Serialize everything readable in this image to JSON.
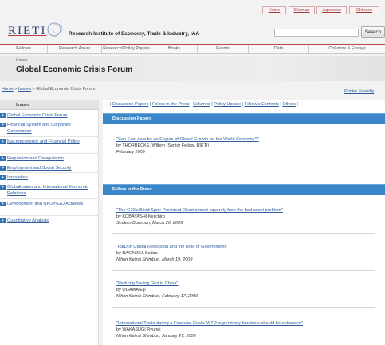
{
  "top_links": [
    "Home",
    "Sitemap",
    "Japanese",
    "Chinese"
  ],
  "logo": {
    "text": "RIETI",
    "institute": "Research Institute of Economy, Trade & Industry, IAA"
  },
  "search": {
    "button": "Search",
    "value": ""
  },
  "nav": [
    "Fellows",
    "Research Areas",
    "Research/Policy Papers",
    "Books",
    "Events",
    "Data",
    "Columns & Essays"
  ],
  "banner": {
    "small": "Issues",
    "title": "Global Economic Crisis Forum"
  },
  "breadcrumb": {
    "home": "Home",
    "sep1": " > ",
    "issues": "Issues",
    "sep2": " > ",
    "current": "Global Economic Crisis Forum"
  },
  "printer": "Printer Friendly",
  "sidebar": {
    "heading": "Issues",
    "items": [
      "Global Economic Crisis Forum",
      "Financial System and Corporate Governance",
      "Macroeconomic and Financial Policy",
      "Regulation and Deregulation",
      "Employment and Social Security",
      "Innovation",
      "Globalization and International Economic Relations",
      "Development and NPO/NGO Activities",
      "Quantitative Analysis"
    ]
  },
  "tablinks": [
    "Discussion Papers",
    "Fellow in the Press",
    "Columns",
    "Policy Update",
    "Fellow's Contents",
    "Others"
  ],
  "discussion": {
    "heading": "Discussion Papers",
    "items": [
      {
        "title": "\"Can East Asia be an Engine of Global Growth for the World Economy?\"",
        "by": "by THORBECKE, Willem (Senior Fellow, RIETI)",
        "date": "February 2009"
      }
    ]
  },
  "press": {
    "heading": "Fellow in the Press",
    "items": [
      {
        "title": "\"The G20's Blind Spot: President Obama must squarely face the bad asset problem\"",
        "by": "by KOBAYASHI Keiichiro",
        "src": "Shukan Bunshun, March 26, 2009"
      },
      {
        "title": "\"R&D in Global Recession and the Role of Government\"",
        "by": "by NAGAOKA Sadao",
        "src": "Nihon Keizai Shimbun, March 19, 2009"
      },
      {
        "title": "\"Reduing Saving Glut in China\"",
        "by": "by OGAWA Eiji",
        "src": "Nihon Keizai Shimbun, February 17, 2009"
      },
      {
        "title": "\"International Trade during a Financial Crisis: WTO supervisory functions should be enhanced\"",
        "by": "by WAKASUGI Ryuhei",
        "src": "Nihon Keizai Shimbun, January 27, 2009"
      }
    ]
  },
  "colors": {
    "accent_red": "#b54848",
    "section_blue": "#3a86c8",
    "link_blue": "#2d5b9e"
  }
}
